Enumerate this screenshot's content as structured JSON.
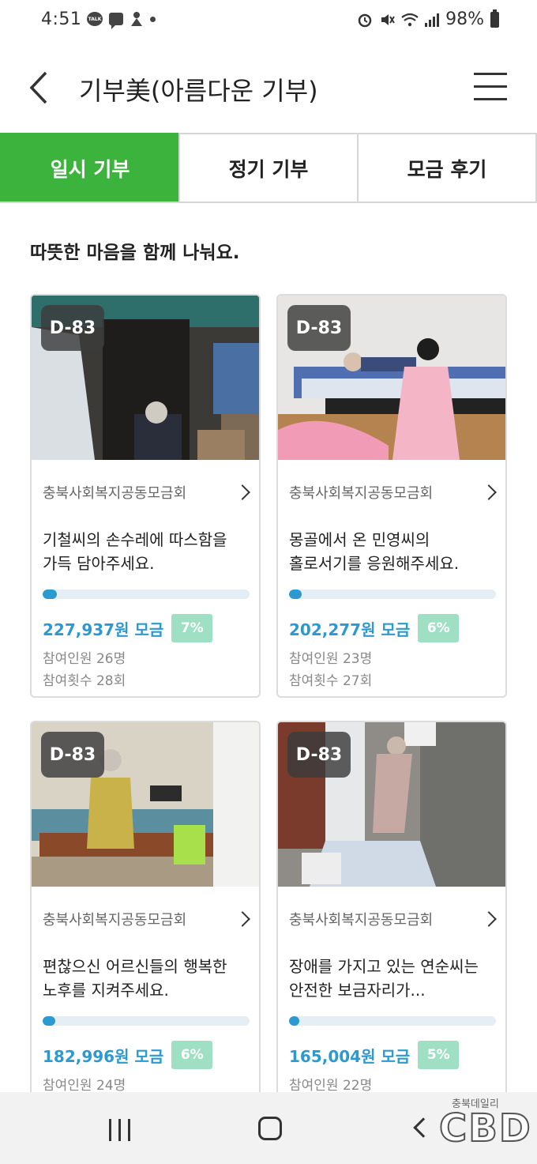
{
  "status_bar": {
    "time": "4:51",
    "talk_label": "TALK",
    "battery": "98%"
  },
  "app_bar": {
    "title": "기부美(아름다운 기부)"
  },
  "tabs": [
    {
      "label": "일시 기부",
      "active": true
    },
    {
      "label": "정기 기부",
      "active": false
    },
    {
      "label": "모금 후기",
      "active": false
    }
  ],
  "section_title": "따뜻한 마음을 함께 나눠요.",
  "cards": [
    {
      "dday": "D-83",
      "org": "충북사회복지공동모금회",
      "desc_line1": "기철씨의 손수레에 따스함을",
      "desc_line2": "가득 담아주세요.",
      "amount": "227,937원 모금",
      "percent": "7%",
      "progress": 0.07,
      "participants": "참여인원 26명",
      "count": "참여횟수 28회"
    },
    {
      "dday": "D-83",
      "org": "충북사회복지공동모금회",
      "desc_line1": "몽골에서 온 민영씨의",
      "desc_line2": "홀로서기를 응원해주세요.",
      "amount": "202,277원 모금",
      "percent": "6%",
      "progress": 0.06,
      "participants": "참여인원 23명",
      "count": "참여횟수 27회"
    },
    {
      "dday": "D-83",
      "org": "충북사회복지공동모금회",
      "desc_line1": "편찮으신 어르신들의 행복한",
      "desc_line2": "노후를 지켜주세요.",
      "amount": "182,996원 모금",
      "percent": "6%",
      "progress": 0.06,
      "participants": "참여인원 24명",
      "count": ""
    },
    {
      "dday": "D-83",
      "org": "충북사회복지공동모금회",
      "desc_line1": "장애를 가지고 있는 연순씨는",
      "desc_line2": "안전한 보금자리가...",
      "amount": "165,004원 모금",
      "percent": "5%",
      "progress": 0.05,
      "participants": "참여인원 22명",
      "count": ""
    }
  ],
  "watermark": {
    "small": "충북데일리",
    "big": "CBD"
  },
  "colors": {
    "accent_green": "#3cb33c",
    "amount_blue": "#2c9ad0",
    "percent_badge": "#9fe0c4"
  }
}
